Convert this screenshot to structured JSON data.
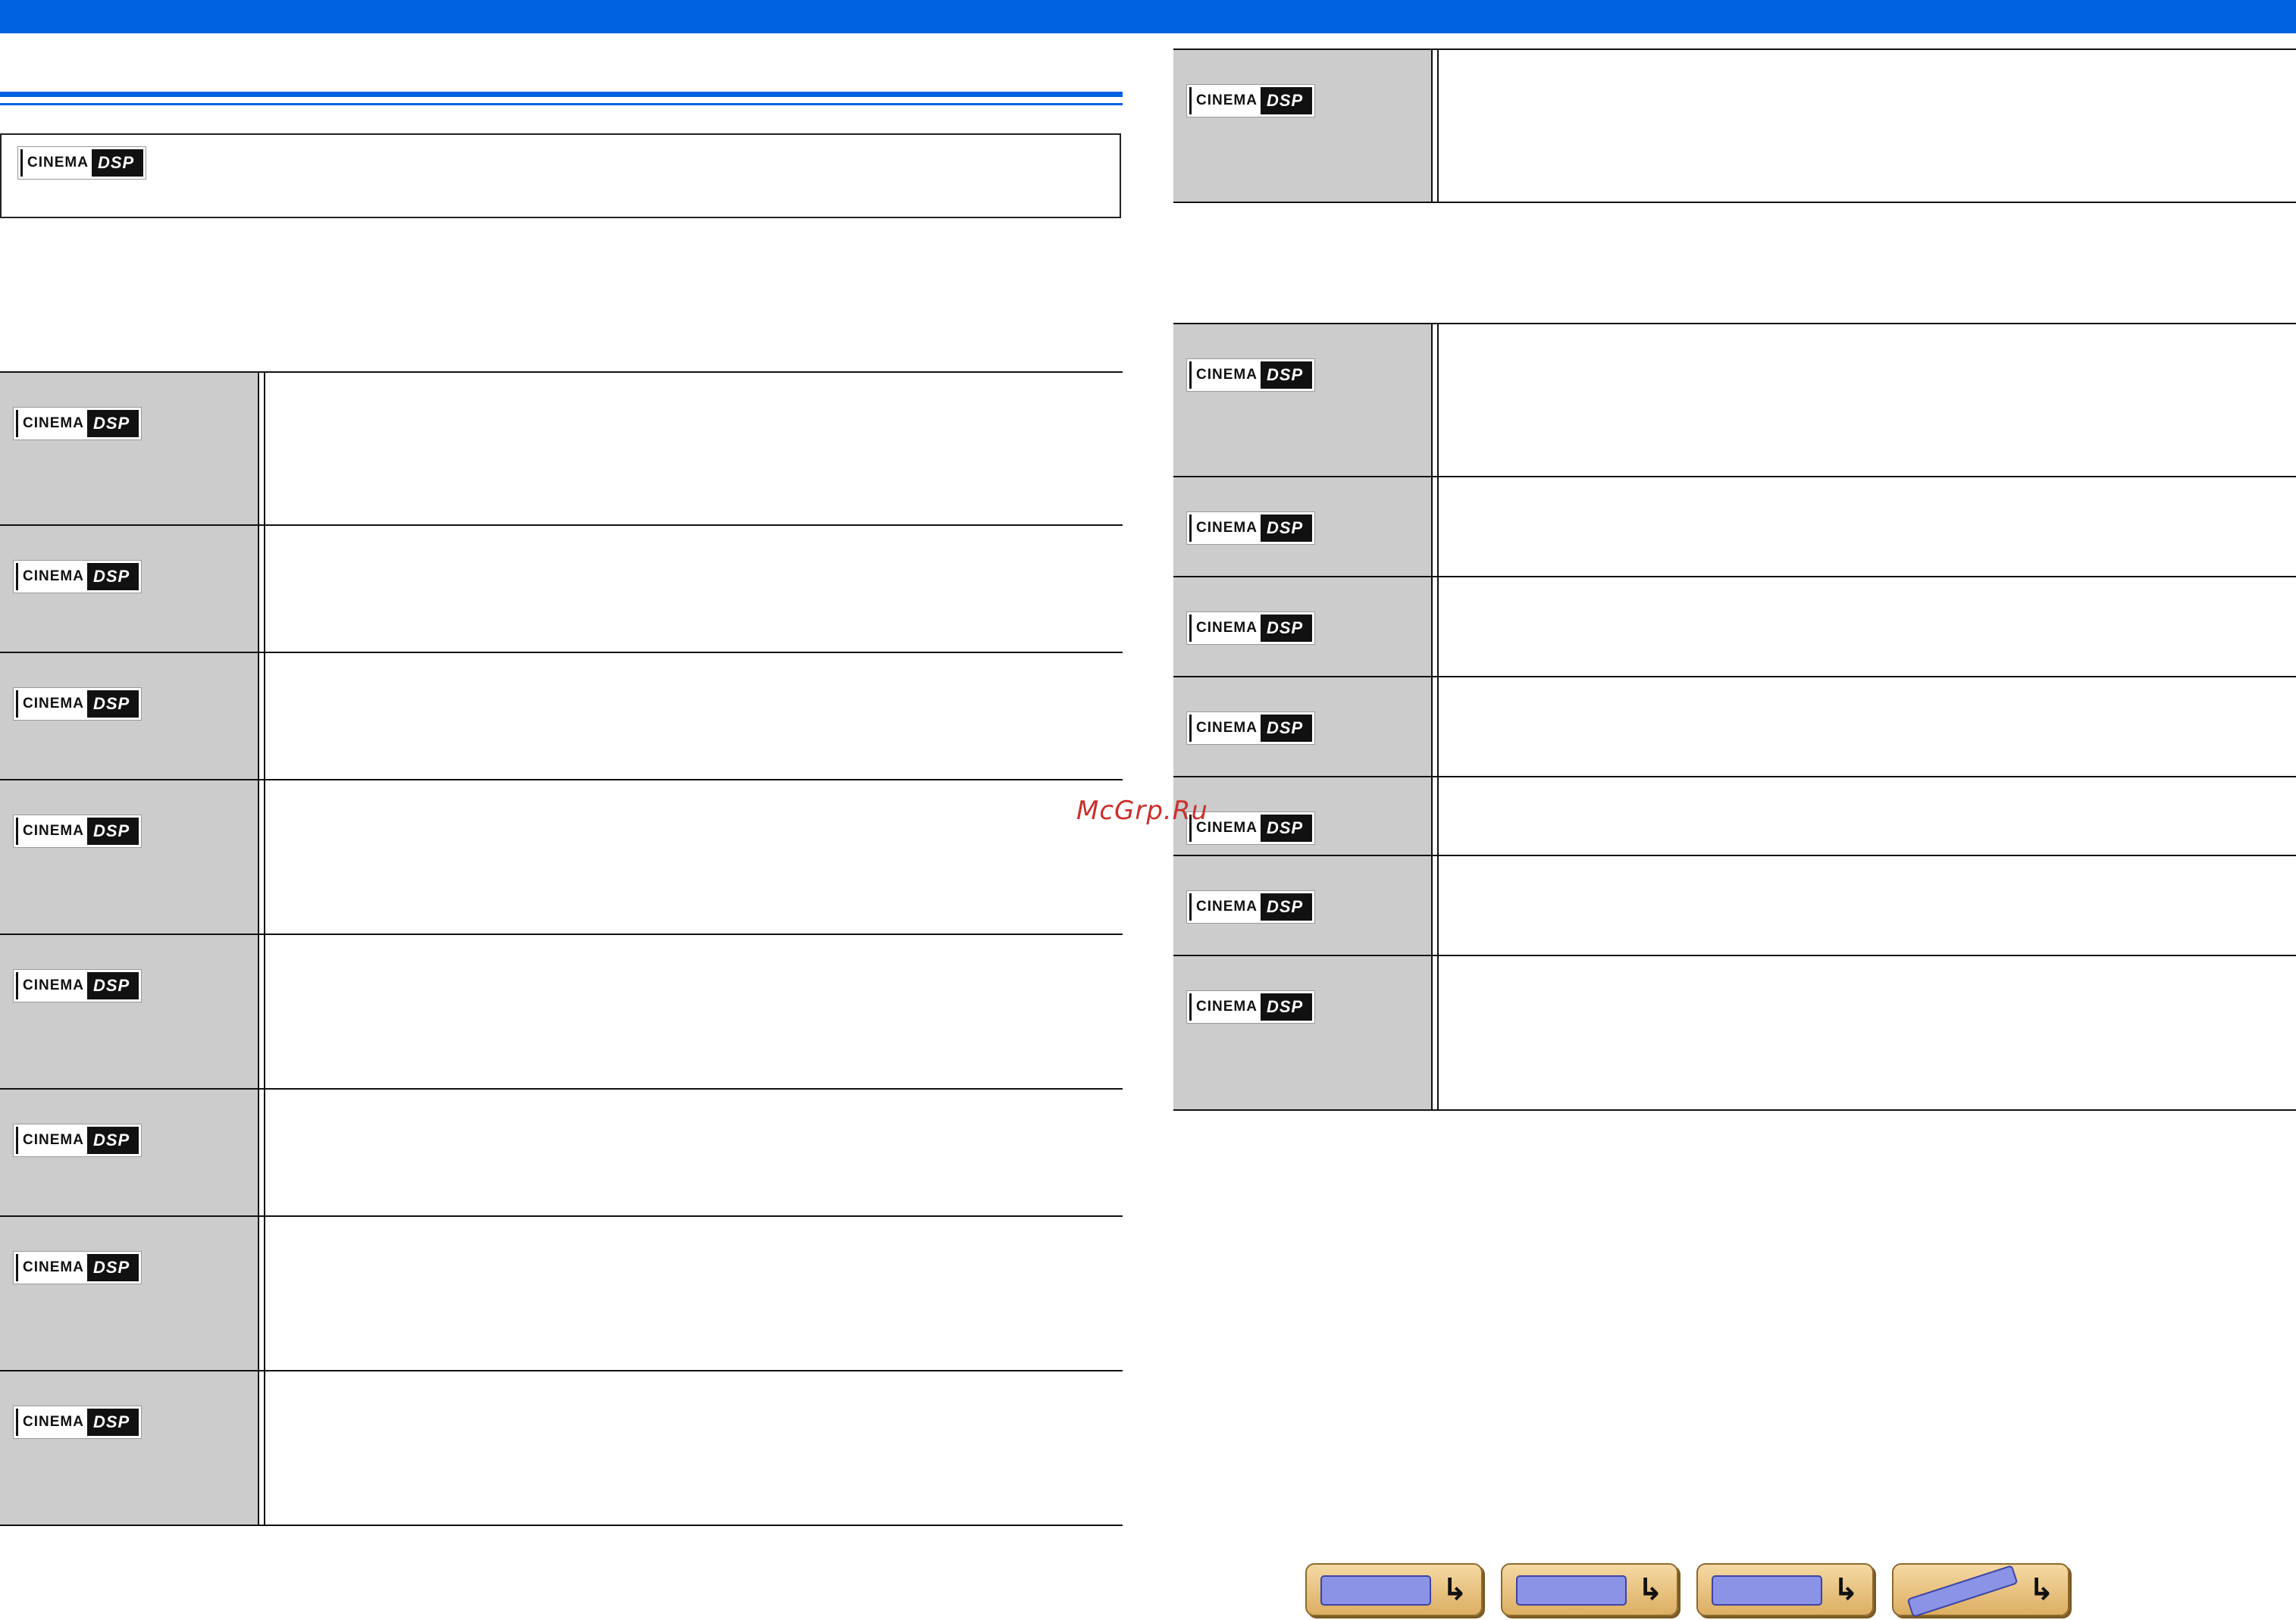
{
  "logo": {
    "left_text": "CINEMA",
    "right_text": "DSP"
  },
  "watermark": "McGrp.Ru",
  "left_rows": 8,
  "right_top_rows": 1,
  "right_bottom_rows": 7,
  "nav": [
    {
      "name": "front-panel-nav-button",
      "icon": "front-panel-icon"
    },
    {
      "name": "rear-panel-nav-button",
      "icon": "rear-panel-icon"
    },
    {
      "name": "display-nav-button",
      "icon": "display-icon"
    },
    {
      "name": "remote-control-nav-button",
      "icon": "remote-control-icon"
    }
  ]
}
